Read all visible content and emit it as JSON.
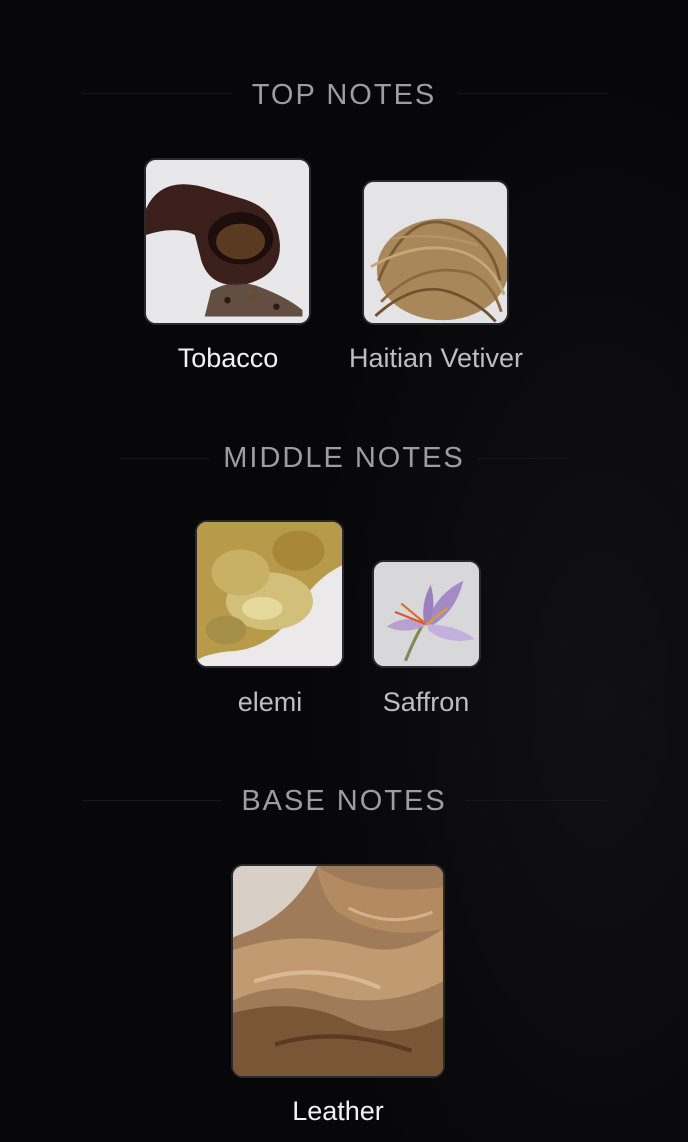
{
  "sections": {
    "top": {
      "title": "TOP NOTES",
      "notes": [
        {
          "label": "Tobacco",
          "icon": "tobacco-pipe-image"
        },
        {
          "label": "Haitian Vetiver",
          "icon": "vetiver-roots-image"
        }
      ]
    },
    "middle": {
      "title": "MIDDLE NOTES",
      "notes": [
        {
          "label": "elemi",
          "icon": "elemi-resin-image"
        },
        {
          "label": "Saffron",
          "icon": "saffron-flower-image"
        }
      ]
    },
    "base": {
      "title": "BASE NOTES",
      "notes": [
        {
          "label": "Leather",
          "icon": "leather-image"
        }
      ]
    }
  }
}
